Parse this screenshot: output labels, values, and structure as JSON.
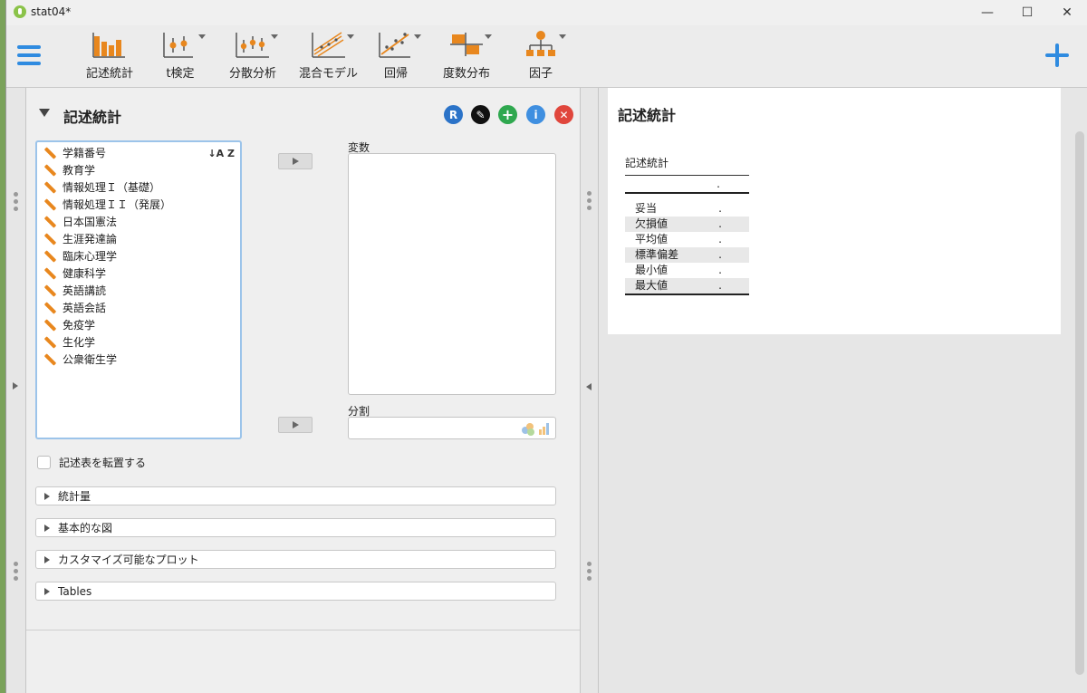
{
  "window": {
    "title": "stat04*",
    "controls": [
      "—",
      "☐",
      "✕"
    ]
  },
  "ribbon": {
    "buttons": [
      {
        "label": "記述統計",
        "icon": "bar-chart-icon",
        "has_menu": false
      },
      {
        "label": "t検定",
        "icon": "t-test-icon",
        "has_menu": true
      },
      {
        "label": "分散分析",
        "icon": "anova-icon",
        "has_menu": true
      },
      {
        "label": "混合モデル",
        "icon": "mixed-model-icon",
        "has_menu": true
      },
      {
        "label": "回帰",
        "icon": "regression-icon",
        "has_menu": true
      },
      {
        "label": "度数分布",
        "icon": "frequencies-icon",
        "has_menu": true
      },
      {
        "label": "因子",
        "icon": "factor-icon",
        "has_menu": true
      }
    ]
  },
  "analysis": {
    "title": "記述統計",
    "header_buttons": [
      {
        "name": "r-syntax-button",
        "glyph": "R",
        "color": "#2b73c8"
      },
      {
        "name": "edit-button",
        "glyph": "✎",
        "color": "#111111"
      },
      {
        "name": "add-button",
        "glyph": "+",
        "color": "#2fa84f"
      },
      {
        "name": "info-button",
        "glyph": "i",
        "color": "#3f8fe0"
      },
      {
        "name": "close-button",
        "glyph": "✕",
        "color": "#e0463c"
      }
    ],
    "variables": [
      "学籍番号",
      "教育学",
      "情報処理Ｉ（基礎）",
      "情報処理ＩＩ（発展）",
      "日本国憲法",
      "生涯発達論",
      "臨床心理学",
      "健康科学",
      "英語講読",
      "英語会話",
      "免疫学",
      "生化学",
      "公衆衛生学"
    ],
    "sort_label": "↓A Z",
    "variables_box_label": "変数",
    "split_box_label": "分割",
    "transpose_label": "記述表を転置する",
    "sections": [
      "統計量",
      "基本的な図",
      "カスタマイズ可能なプロット",
      "Tables"
    ]
  },
  "results": {
    "title": "記述統計",
    "table_title": "記述統計",
    "header_value": ".",
    "rows": [
      {
        "label": "妥当",
        "value": "."
      },
      {
        "label": "欠損値",
        "value": "."
      },
      {
        "label": "平均値",
        "value": "."
      },
      {
        "label": "標準偏差",
        "value": "."
      },
      {
        "label": "最小値",
        "value": "."
      },
      {
        "label": "最大値",
        "value": "."
      }
    ]
  }
}
